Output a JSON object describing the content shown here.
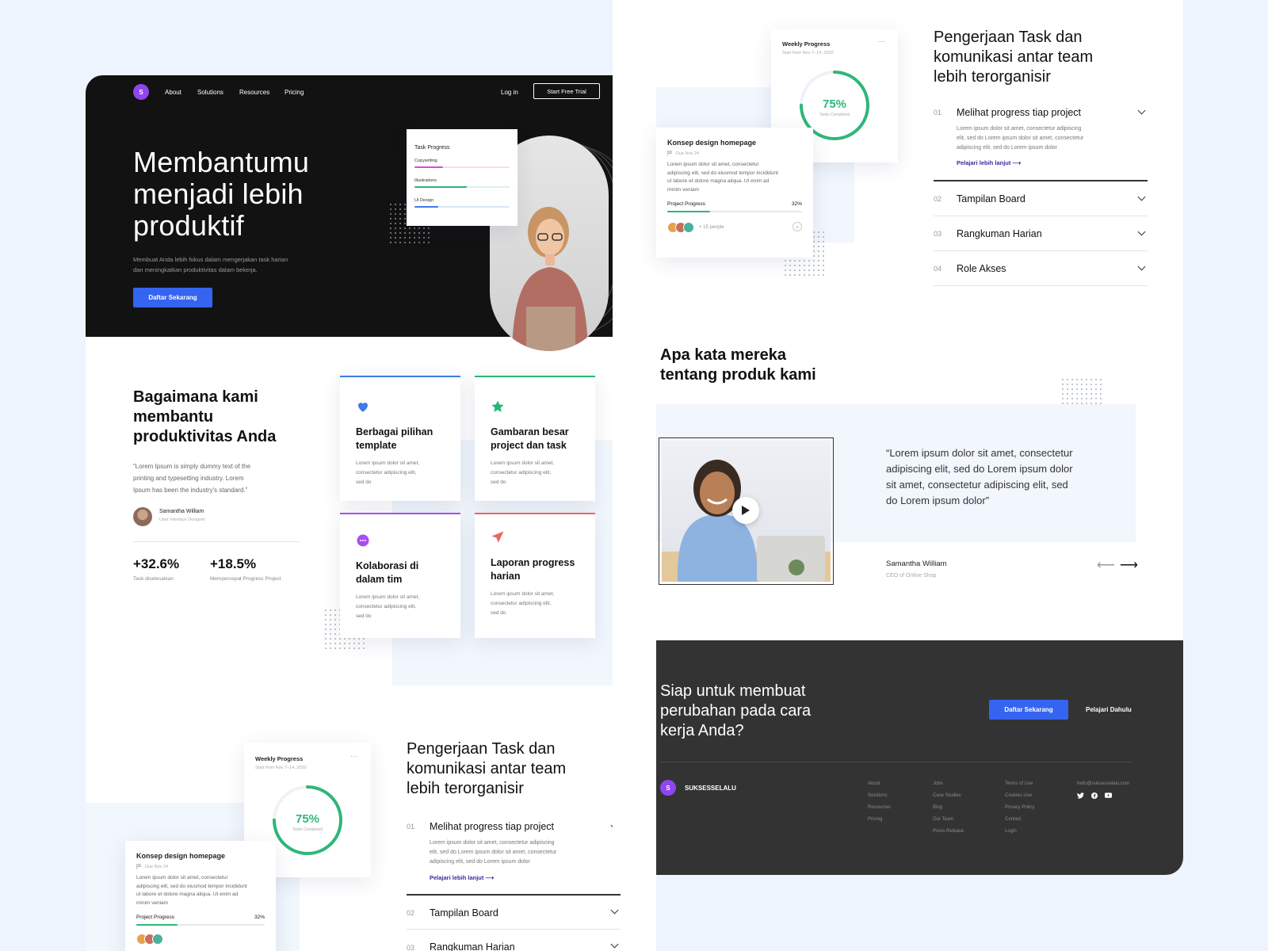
{
  "nav": {
    "logo": "S",
    "links": [
      "About",
      "Solutions",
      "Resources",
      "Pricing"
    ],
    "login": "Log in",
    "trial": "Start Free Trial"
  },
  "hero": {
    "title_l1": "Membantumu",
    "title_l2": "menjadi lebih",
    "title_l3": "produktif",
    "subtitle_l1": "Membuat Anda lebih fokus dalam mengerjakan task harian",
    "subtitle_l2": "dan meningkatkan produktivitas dalam bekerja.",
    "cta": "Daftar Sekarang",
    "task_card": {
      "title": "Task Progress",
      "items": [
        {
          "label": "Copywriting",
          "progress": 0.3,
          "color": "#d24dd8",
          "track": "#f6dbf7"
        },
        {
          "label": "Illustrations",
          "progress": 0.55,
          "color": "#27b577",
          "track": "#d9f2e7"
        },
        {
          "label": "UI Design",
          "progress": 0.25,
          "color": "#3e7ae8",
          "track": "#dbe6fb"
        }
      ]
    }
  },
  "how": {
    "title_l1": "Bagaimana kami",
    "title_l2": "membantu",
    "title_l3": "produktivitas Anda",
    "quote_l1": "“Lorem Ipsum is simply dummy text of the",
    "quote_l2": "printing and typesetting industry. Lorem",
    "quote_l3": "Ipsum has been the industry's standard.”",
    "author": "Samantha William",
    "author_role": "User Interface Designer",
    "stats": [
      {
        "value": "+32.6%",
        "label": "Task diselesaikan"
      },
      {
        "value": "+18.5%",
        "label": "Mempercepat Progress Project"
      }
    ]
  },
  "features": [
    {
      "title_l1": "Berbagai pilihan",
      "title_l2": "template",
      "icon": "heart-icon",
      "color": "#3e7ae8"
    },
    {
      "title_l1": "Gambaran besar",
      "title_l2": "project dan task",
      "icon": "star-icon",
      "color": "#27b577"
    },
    {
      "title_l1": "Kolaborasi di",
      "title_l2": "dalam tim",
      "icon": "chat-icon",
      "color": "#a74ff0"
    },
    {
      "title_l1": "Laporan progress",
      "title_l2": "harian",
      "icon": "send-icon",
      "color": "#ef6461"
    }
  ],
  "feature_body": [
    "Lorem ipsum dolor sit amet,",
    "consectetur adipiscing elit,",
    "sed do"
  ],
  "organize": {
    "title_l1": "Pengerjaan Task dan",
    "title_l2": "komunikasi antar team",
    "title_l3": "lebih terorganisir",
    "items": [
      {
        "num": "01",
        "title": "Melihat progress tiap project"
      },
      {
        "num": "02",
        "title": "Tampilan Board"
      },
      {
        "num": "03",
        "title": "Rangkuman Harian"
      },
      {
        "num": "04",
        "title": "Role Akses"
      }
    ],
    "body_l1": "Lorem ipsum dolor sit amet, consectetur adipiscing",
    "body_l2": "elit, sed do Lorem ipsum dolor sit amet, consectetur",
    "body_l3": "adipiscing elit, sed do Lorem ipsum dolor",
    "link": "Pelajari lebih lanjut ⟶"
  },
  "weekly": {
    "title": "Weekly Progress",
    "sub": "Start from Nov 7–14, 2020",
    "menu": "···",
    "pct": "75%",
    "pct_value": 0.75,
    "label": "Tasks Completed"
  },
  "task": {
    "title": "Konsep design homepage",
    "due": "Due Nov 24",
    "body_l1": "Lorem ipsum dolor sit amet, consectetur",
    "body_l2": "adipiscing elit, sed do eiusmod tempor incididunt",
    "body_l3": "ut labore et dolore magna aliqua. Ut enim ad",
    "body_l4": "minim veniam",
    "progress_label": "Project Progress",
    "progress_pct": "32%",
    "progress_value": 0.32,
    "people": "+ 15 people",
    "plus": "+"
  },
  "testimonial": {
    "title_l1": "Apa kata mereka",
    "title_l2": "tentang produk kami",
    "quote_l1": "“Lorem ipsum dolor sit amet, consectetur",
    "quote_l2": "adipiscing elit, sed do Lorem ipsum dolor",
    "quote_l3": "sit amet, consectetur adipiscing elit, sed",
    "quote_l4": "do Lorem ipsum dolor”",
    "author": "Samantha William",
    "role": "CEO of Online Shop",
    "prev": "⟵",
    "next": "⟶"
  },
  "cta": {
    "title_l1": "Siap untuk membuat",
    "title_l2": "perubahan pada cara",
    "title_l3": "kerja Anda?",
    "primary": "Daftar Sekarang",
    "secondary": "Pelajari Dahulu"
  },
  "footer": {
    "logo": "S",
    "brand": "SUKSESSELALU",
    "col1": [
      "About",
      "Solutions",
      "Resources",
      "Pricing"
    ],
    "col2": [
      "Jobs",
      "Case Studies",
      "Blog",
      "Our Team",
      "Press Release"
    ],
    "col3": [
      "Terms of Use",
      "Cookies Use",
      "Privacy Policy",
      "Contact",
      "Login"
    ],
    "email": "hello@suksesselalu.com",
    "social": [
      "twitter-icon",
      "facebook-icon",
      "youtube-icon"
    ]
  },
  "colors": {
    "accent": "#3564f0",
    "green": "#2fb67a",
    "purple": "#8f45f0",
    "dark": "#121212",
    "cta_bg": "#333333"
  }
}
